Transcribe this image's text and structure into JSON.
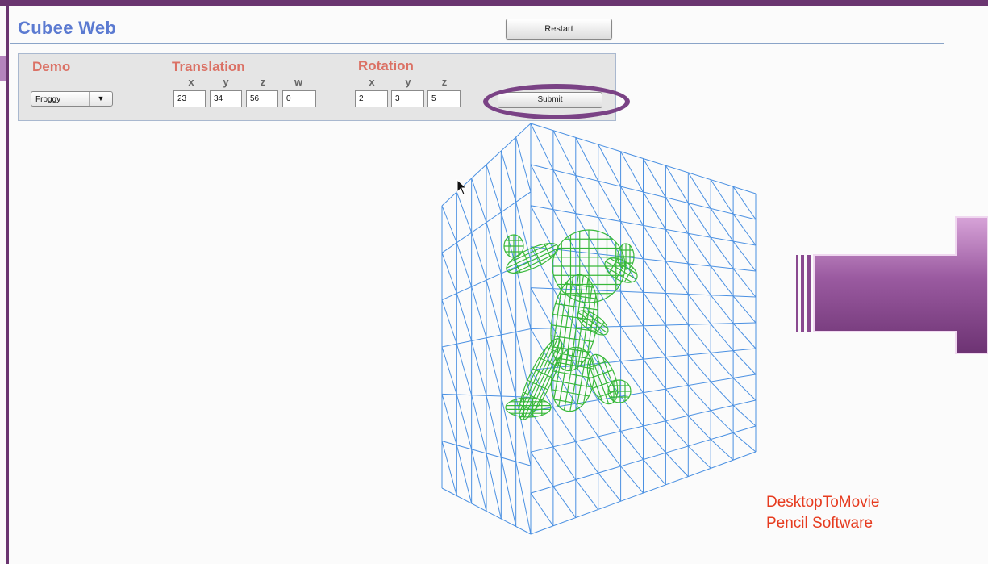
{
  "app": {
    "title": "Cubee Web"
  },
  "toolbar": {
    "restart_label": "Restart"
  },
  "panel": {
    "demo": {
      "label": "Demo",
      "selected": "Froggy"
    },
    "translation": {
      "label": "Translation",
      "axes": [
        "x",
        "y",
        "z",
        "w"
      ],
      "values": [
        "23",
        "34",
        "56",
        "0"
      ]
    },
    "rotation": {
      "label": "Rotation",
      "axes": [
        "x",
        "y",
        "z"
      ],
      "values": [
        "2",
        "3",
        "5"
      ]
    },
    "submit_label": "Submit"
  },
  "overlay": {
    "watermark_line1": "DesktopToMovie",
    "watermark_line2": "Pencil Software"
  },
  "colors": {
    "accent": "#5b7ad1",
    "section_heading": "#db7165",
    "wireframe_cube": "#4a90e2",
    "frog_mesh": "#38b83a",
    "annotation": "#7a4285",
    "watermark": "#e63b1f"
  }
}
